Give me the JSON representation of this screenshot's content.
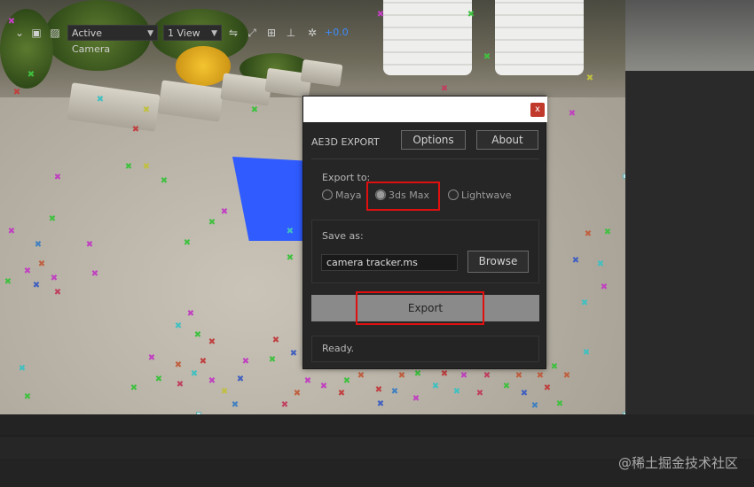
{
  "dialog": {
    "close_label": "x",
    "title": "AE3D EXPORT",
    "options_label": "Options",
    "about_label": "About",
    "export_to_label": "Export to:",
    "targets": [
      {
        "label": "Maya",
        "selected": false
      },
      {
        "label": "3ds Max",
        "selected": true
      },
      {
        "label": "Lightwave",
        "selected": false
      }
    ],
    "save_as_label": "Save as:",
    "filename_value": "camera tracker.ms",
    "browse_label": "Browse",
    "export_label": "Export",
    "status": "Ready."
  },
  "viewer_toolbar": {
    "camera_select": "Active Camera",
    "view_select": "1 View",
    "exposure_value": "+0.0"
  },
  "watermark": "@稀土掘金技术社区",
  "colors": {
    "highlight": "#e01010",
    "accent_blue": "#3d8cff",
    "plane_blue": "#2f5bff"
  }
}
